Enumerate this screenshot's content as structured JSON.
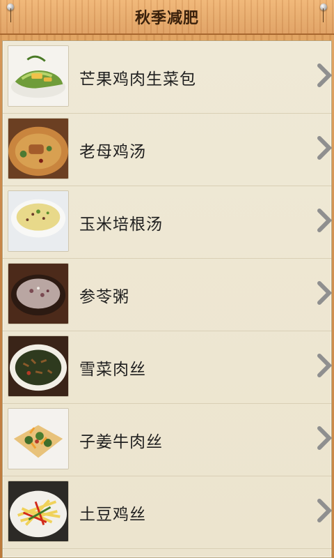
{
  "header": {
    "title": "秋季减肥"
  },
  "list": {
    "items": [
      {
        "label": "芒果鸡肉生菜包",
        "icon": "dish-photo"
      },
      {
        "label": "老母鸡汤",
        "icon": "dish-photo"
      },
      {
        "label": "玉米培根汤",
        "icon": "dish-photo"
      },
      {
        "label": "参苓粥",
        "icon": "dish-photo"
      },
      {
        "label": "雪菜肉丝",
        "icon": "dish-photo"
      },
      {
        "label": "子姜牛肉丝",
        "icon": "dish-photo"
      },
      {
        "label": "土豆鸡丝",
        "icon": "dish-photo"
      }
    ]
  },
  "colors": {
    "text": "#1f1f1f",
    "paper": "#efe9d6",
    "wood": "#d69a5a",
    "chevron": "#8f8f8f"
  }
}
